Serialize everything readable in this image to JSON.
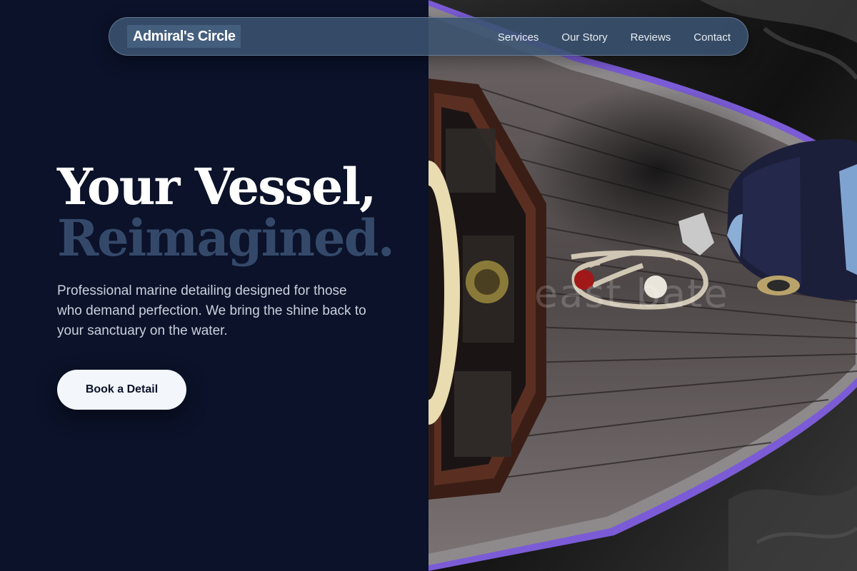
{
  "nav": {
    "brand": "Admiral's Circle",
    "links": [
      "Services",
      "Our Story",
      "Reviews",
      "Contact"
    ]
  },
  "hero": {
    "title_line1": "Your Vessel,",
    "title_line2": "Reimagined.",
    "subtitle": "Professional marine detailing designed for those who demand perfection. We bring the shine back to your sanctuary on the water.",
    "cta_label": "Book a Detail"
  },
  "photo": {
    "watermark": "east bate"
  },
  "colors": {
    "background": "#0b1229",
    "accent_muted": "#34496a",
    "cta_bg": "#f3f6fa",
    "nav_bg": "#3a5270",
    "hull_trim": "#7b5cd6"
  },
  "icons": {
    "boat_photo": "boat-deck-photo"
  }
}
